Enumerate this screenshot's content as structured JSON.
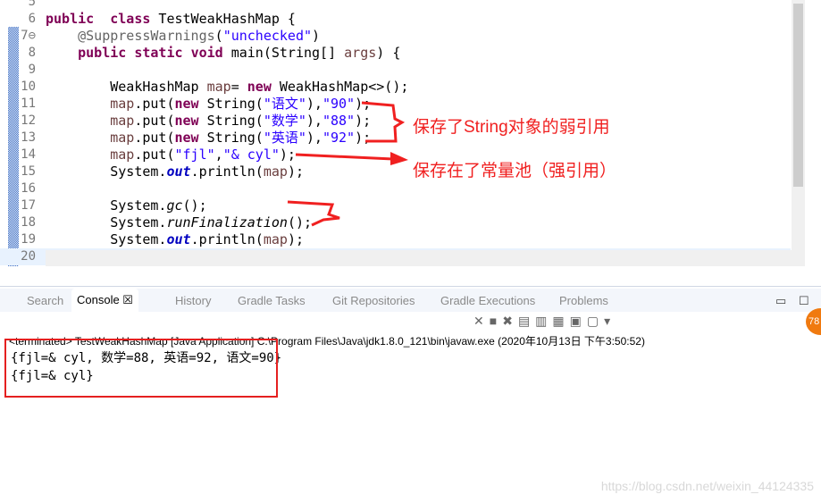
{
  "editor": {
    "lines": [
      {
        "n": "5",
        "t": []
      },
      {
        "n": "6",
        "t": [
          [
            "kw",
            "public"
          ],
          [
            "",
            "  "
          ],
          [
            "kw",
            "class"
          ],
          [
            "",
            " TestWeakHashMap {"
          ]
        ]
      },
      {
        "n": "7⊖",
        "t": [
          [
            "",
            "    "
          ],
          [
            "ann",
            "@SuppressWarnings"
          ],
          [
            "",
            "("
          ],
          [
            "str",
            "\"unchecked\""
          ],
          [
            "",
            ")"
          ]
        ]
      },
      {
        "n": "8",
        "t": [
          [
            "",
            "    "
          ],
          [
            "kw",
            "public"
          ],
          [
            "",
            " "
          ],
          [
            "kw",
            "static"
          ],
          [
            "",
            " "
          ],
          [
            "kw",
            "void"
          ],
          [
            "",
            " main(String[] "
          ],
          [
            "var",
            "args"
          ],
          [
            "",
            ") {"
          ]
        ]
      },
      {
        "n": "9",
        "t": []
      },
      {
        "n": "10",
        "t": [
          [
            "",
            "        WeakHashMap "
          ],
          [
            "var",
            "map"
          ],
          [
            "",
            "= "
          ],
          [
            "kw",
            "new"
          ],
          [
            "",
            " WeakHashMap<>();"
          ]
        ]
      },
      {
        "n": "11",
        "t": [
          [
            "",
            "        "
          ],
          [
            "var",
            "map"
          ],
          [
            "",
            ".put("
          ],
          [
            "kw",
            "new"
          ],
          [
            "",
            " String("
          ],
          [
            "str",
            "\"语文\""
          ],
          [
            "",
            "),"
          ],
          [
            "str",
            "\"90\""
          ],
          [
            "",
            ");"
          ]
        ]
      },
      {
        "n": "12",
        "t": [
          [
            "",
            "        "
          ],
          [
            "var",
            "map"
          ],
          [
            "",
            ".put("
          ],
          [
            "kw",
            "new"
          ],
          [
            "",
            " String("
          ],
          [
            "str",
            "\"数学\""
          ],
          [
            "",
            "),"
          ],
          [
            "str",
            "\"88\""
          ],
          [
            "",
            ");"
          ]
        ]
      },
      {
        "n": "13",
        "t": [
          [
            "",
            "        "
          ],
          [
            "var",
            "map"
          ],
          [
            "",
            ".put("
          ],
          [
            "kw",
            "new"
          ],
          [
            "",
            " String("
          ],
          [
            "str",
            "\"英语\""
          ],
          [
            "",
            "),"
          ],
          [
            "str",
            "\"92\""
          ],
          [
            "",
            ");"
          ]
        ]
      },
      {
        "n": "14",
        "t": [
          [
            "",
            "        "
          ],
          [
            "var",
            "map"
          ],
          [
            "",
            ".put("
          ],
          [
            "str",
            "\"fjl\""
          ],
          [
            "",
            ","
          ],
          [
            "str",
            "\"& cyl\""
          ],
          [
            "",
            ");"
          ]
        ]
      },
      {
        "n": "15",
        "t": [
          [
            "",
            "        System."
          ],
          [
            "fld",
            "out"
          ],
          [
            "",
            ".println("
          ],
          [
            "var",
            "map"
          ],
          [
            "",
            ");"
          ]
        ]
      },
      {
        "n": "16",
        "t": []
      },
      {
        "n": "17",
        "t": [
          [
            "",
            "        System."
          ],
          [
            "it",
            "gc"
          ],
          [
            "",
            "();"
          ]
        ]
      },
      {
        "n": "18",
        "t": [
          [
            "",
            "        System."
          ],
          [
            "it",
            "runFinalization"
          ],
          [
            "",
            "();"
          ]
        ]
      },
      {
        "n": "19",
        "t": [
          [
            "",
            "        System."
          ],
          [
            "fld",
            "out"
          ],
          [
            "",
            ".println("
          ],
          [
            "var",
            "map"
          ],
          [
            "",
            ");"
          ]
        ]
      },
      {
        "n": "20",
        "t": []
      }
    ]
  },
  "annotations": {
    "weak": "保存了String对象的弱引用",
    "strong": "保存在了常量池（强引用）"
  },
  "console": {
    "tabs": [
      "Search",
      "Console ☒",
      "History",
      "Gradle Tasks",
      "Git Repositories",
      "Gradle Executions",
      "Problems"
    ],
    "terminated": "<terminated> TestWeakHashMap [Java Application] C:\\Program Files\\Java\\jdk1.8.0_121\\bin\\javaw.exe (2020年10月13日 下午3:50:52)",
    "output": [
      "{fjl=& cyl, 数学=88, 英语=92, 语文=90}",
      "{fjl=& cyl}"
    ]
  },
  "badge": "78",
  "watermark": "https://blog.csdn.net/weixin_44124335",
  "colors": {
    "annotation": "#f02020",
    "keyword": "#7f0055",
    "string": "#2a00ff"
  }
}
